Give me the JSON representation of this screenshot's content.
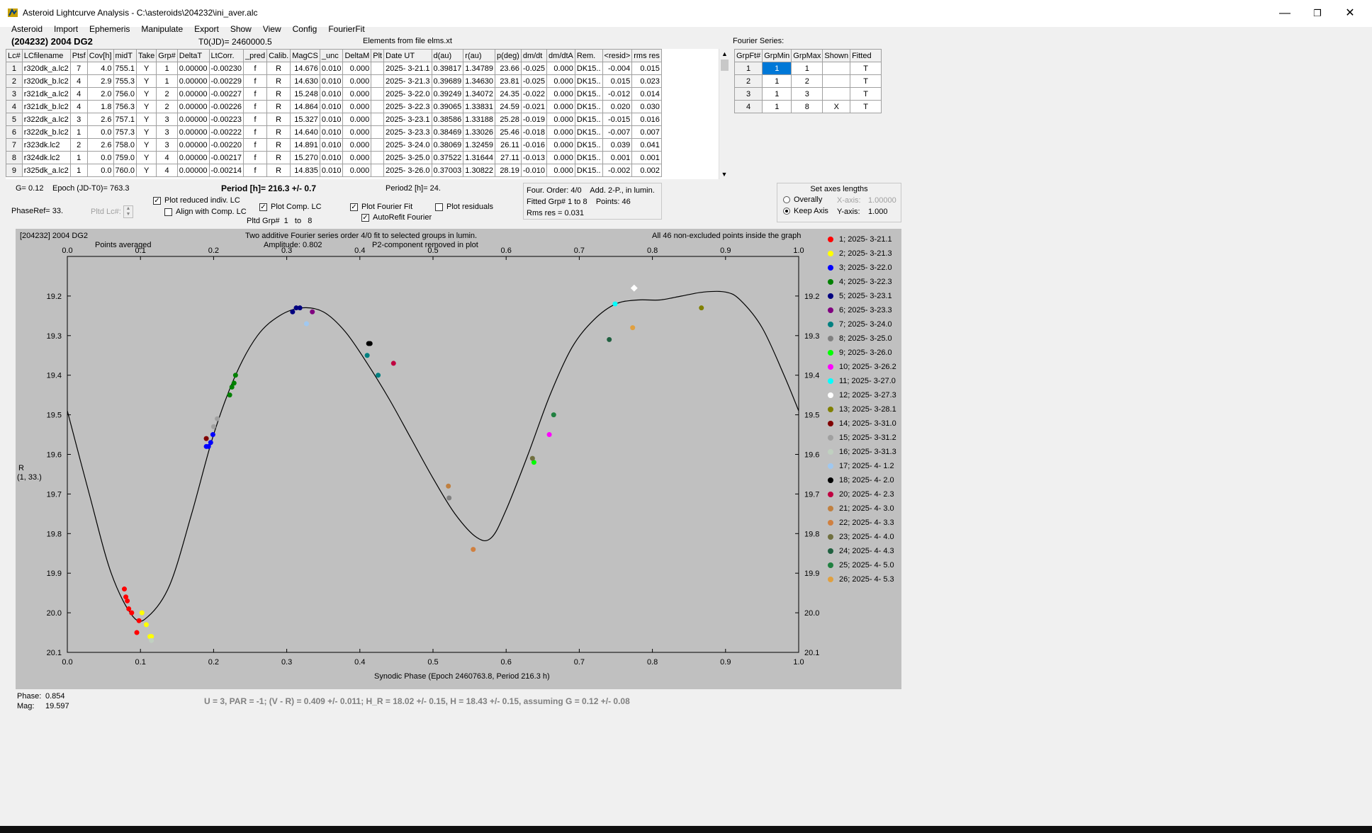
{
  "window": {
    "title": "Asteroid Lightcurve Analysis - C:\\asteroids\\204232\\ini_aver.alc"
  },
  "menu": [
    "Asteroid",
    "Import",
    "Ephemeris",
    "Manipulate",
    "Export",
    "Show",
    "View",
    "Config",
    "FourierFit"
  ],
  "header": {
    "asteroid": "(204232) 2004 DG2",
    "t0": "T0(JD)= 2460000.5",
    "elements": "Elements from file elms.xt",
    "fourier_series_label": "Fourier Series:"
  },
  "lc_table": {
    "columns": [
      "Lc#",
      "LCfilename",
      "Ptsf",
      "Cov[h]",
      "midT",
      "Take",
      "Grp#",
      "DeltaT",
      "LtCorr.",
      "_pred",
      "Calib.",
      "MagCS",
      "_unc",
      "DeltaM",
      "Plt",
      "Date UT",
      "d(au)",
      "r(au)",
      "p(deg)",
      "dm/dt",
      "dm/dtA",
      "Rem.",
      "<resid>",
      "rms res"
    ],
    "rows": [
      [
        "1",
        "r320dk_a.lc2",
        "7",
        "4.0",
        "755.1",
        "Y",
        "1",
        "0.00000",
        "-0.00230",
        "f",
        "R",
        "14.676",
        "0.010",
        "0.000",
        "",
        "2025- 3-21.1",
        "0.39817",
        "1.34789",
        "23.66",
        "-0.025",
        "0.000",
        "DK15..",
        "-0.004",
        "0.015"
      ],
      [
        "2",
        "r320dk_b.lc2",
        "4",
        "2.9",
        "755.3",
        "Y",
        "1",
        "0.00000",
        "-0.00229",
        "f",
        "R",
        "14.630",
        "0.010",
        "0.000",
        "",
        "2025- 3-21.3",
        "0.39689",
        "1.34630",
        "23.81",
        "-0.025",
        "0.000",
        "DK15..",
        "0.015",
        "0.023"
      ],
      [
        "3",
        "r321dk_a.lc2",
        "4",
        "2.0",
        "756.0",
        "Y",
        "2",
        "0.00000",
        "-0.00227",
        "f",
        "R",
        "15.248",
        "0.010",
        "0.000",
        "",
        "2025- 3-22.0",
        "0.39249",
        "1.34072",
        "24.35",
        "-0.022",
        "0.000",
        "DK15..",
        "-0.012",
        "0.014"
      ],
      [
        "4",
        "r321dk_b.lc2",
        "4",
        "1.8",
        "756.3",
        "Y",
        "2",
        "0.00000",
        "-0.00226",
        "f",
        "R",
        "14.864",
        "0.010",
        "0.000",
        "",
        "2025- 3-22.3",
        "0.39065",
        "1.33831",
        "24.59",
        "-0.021",
        "0.000",
        "DK15..",
        "0.020",
        "0.030"
      ],
      [
        "5",
        "r322dk_a.lc2",
        "3",
        "2.6",
        "757.1",
        "Y",
        "3",
        "0.00000",
        "-0.00223",
        "f",
        "R",
        "15.327",
        "0.010",
        "0.000",
        "",
        "2025- 3-23.1",
        "0.38586",
        "1.33188",
        "25.28",
        "-0.019",
        "0.000",
        "DK15..",
        "-0.015",
        "0.016"
      ],
      [
        "6",
        "r322dk_b.lc2",
        "1",
        "0.0",
        "757.3",
        "Y",
        "3",
        "0.00000",
        "-0.00222",
        "f",
        "R",
        "14.640",
        "0.010",
        "0.000",
        "",
        "2025- 3-23.3",
        "0.38469",
        "1.33026",
        "25.46",
        "-0.018",
        "0.000",
        "DK15..",
        "-0.007",
        "0.007"
      ],
      [
        "7",
        "r323dk.lc2",
        "2",
        "2.6",
        "758.0",
        "Y",
        "3",
        "0.00000",
        "-0.00220",
        "f",
        "R",
        "14.891",
        "0.010",
        "0.000",
        "",
        "2025- 3-24.0",
        "0.38069",
        "1.32459",
        "26.11",
        "-0.016",
        "0.000",
        "DK15..",
        "0.039",
        "0.041"
      ],
      [
        "8",
        "r324dk.lc2",
        "1",
        "0.0",
        "759.0",
        "Y",
        "4",
        "0.00000",
        "-0.00217",
        "f",
        "R",
        "15.270",
        "0.010",
        "0.000",
        "",
        "2025- 3-25.0",
        "0.37522",
        "1.31644",
        "27.11",
        "-0.013",
        "0.000",
        "DK15..",
        "0.001",
        "0.001"
      ],
      [
        "9",
        "r325dk_a.lc2",
        "1",
        "0.0",
        "760.0",
        "Y",
        "4",
        "0.00000",
        "-0.00214",
        "f",
        "R",
        "14.835",
        "0.010",
        "0.000",
        "",
        "2025- 3-26.0",
        "0.37003",
        "1.30822",
        "28.19",
        "-0.010",
        "0.000",
        "DK15..",
        "-0.002",
        "0.002"
      ]
    ]
  },
  "fourier_table": {
    "columns": [
      "GrpFt#",
      "GrpMin",
      "GrpMax",
      "Shown",
      "Fitted"
    ],
    "rows": [
      [
        "1",
        "1",
        "1",
        "",
        "T"
      ],
      [
        "2",
        "1",
        "2",
        "",
        "T"
      ],
      [
        "3",
        "1",
        "3",
        "",
        "T"
      ],
      [
        "4",
        "1",
        "8",
        "X",
        "T"
      ]
    ]
  },
  "controls": {
    "g": "G= 0.12",
    "epoch": "Epoch (JD-T0)= 763.3",
    "period": "Period [h]= 216.3 +/- 0.7",
    "period2": "Period2 [h]= 24.",
    "phaseref": "PhaseRef= 33.",
    "pltd_lc": "Pltd Lc#:",
    "plot_reduced": "Plot reduced indiv. LC",
    "align": "Align with Comp. LC",
    "plot_comp": "Plot Comp. LC",
    "pltd_grp": "Pltd Grp#",
    "pltd_grp_from": "1",
    "pltd_grp_to_label": "to",
    "pltd_grp_to": "8",
    "plot_fourier": "Plot Fourier Fit",
    "autorefit": "AutoRefit Fourier",
    "plot_residuals": "Plot residuals",
    "checks": {
      "plot_reduced": true,
      "align": false,
      "plot_comp": true,
      "plot_fourier": true,
      "autorefit": true,
      "plot_residuals": false
    }
  },
  "fit_info": {
    "order": "Four. Order:  4/0",
    "add": "Add. 2-P., in lumin.",
    "fitted_grp": "Fitted Grp# 1 to 8",
    "points": "Points: 46",
    "rms": "Rms res     = 0.031"
  },
  "axes_box": {
    "title": "Set axes lengths",
    "overally": "Overally",
    "keep_axis": "Keep Axis",
    "xaxis_label": "X-axis:",
    "xaxis_value": "1.00000",
    "yaxis_label": "Y-axis:",
    "yaxis_value": "1.000",
    "selected": "keep_axis"
  },
  "plot": {
    "title_left": "[204232] 2004 DG2",
    "points_averaged": "Points averaged",
    "title_center": "Two additive Fourier series order 4/0 fit to selected groups in lumin.",
    "amplitude": "Amplitude: 0.802",
    "p2": "P2-component removed in plot",
    "title_right": "All 46 non-excluded points inside the graph",
    "ylabel": "R",
    "ylabel2": "(1, 33.)",
    "xlabel": "Synodic Phase (Epoch 2460763.8, Period 216.3 h)"
  },
  "chart_data": {
    "type": "scatter",
    "xlim": [
      0,
      1
    ],
    "ylim": [
      20.1,
      19.1
    ],
    "y_inverted": true,
    "xticks": [
      "0.0",
      "0.1",
      "0.2",
      "0.3",
      "0.4",
      "0.5",
      "0.6",
      "0.7",
      "0.8",
      "0.9",
      "1.0"
    ],
    "yticks": [
      "19.2",
      "19.3",
      "19.4",
      "19.5",
      "19.6",
      "19.7",
      "19.8",
      "19.9",
      "20.0",
      "20.1"
    ],
    "fit_curve": [
      [
        0,
        19.49
      ],
      [
        0.03,
        19.7
      ],
      [
        0.06,
        19.9
      ],
      [
        0.09,
        20.01
      ],
      [
        0.11,
        20.01
      ],
      [
        0.14,
        19.93
      ],
      [
        0.17,
        19.75
      ],
      [
        0.2,
        19.55
      ],
      [
        0.23,
        19.4
      ],
      [
        0.26,
        19.3
      ],
      [
        0.29,
        19.25
      ],
      [
        0.32,
        19.23
      ],
      [
        0.35,
        19.24
      ],
      [
        0.38,
        19.29
      ],
      [
        0.41,
        19.37
      ],
      [
        0.44,
        19.46
      ],
      [
        0.47,
        19.56
      ],
      [
        0.5,
        19.66
      ],
      [
        0.53,
        19.75
      ],
      [
        0.56,
        19.81
      ],
      [
        0.58,
        19.81
      ],
      [
        0.6,
        19.74
      ],
      [
        0.63,
        19.6
      ],
      [
        0.66,
        19.45
      ],
      [
        0.69,
        19.33
      ],
      [
        0.72,
        19.26
      ],
      [
        0.75,
        19.22
      ],
      [
        0.78,
        19.21
      ],
      [
        0.81,
        19.21
      ],
      [
        0.84,
        19.2
      ],
      [
        0.87,
        19.19
      ],
      [
        0.9,
        19.19
      ],
      [
        0.92,
        19.21
      ],
      [
        0.95,
        19.28
      ],
      [
        0.98,
        19.4
      ],
      [
        1.0,
        19.49
      ]
    ],
    "series": [
      {
        "name": "1; 2025- 3-21.1",
        "color": "#ff0000",
        "points": [
          [
            0.078,
            19.94
          ],
          [
            0.08,
            19.96
          ],
          [
            0.082,
            19.97
          ],
          [
            0.084,
            19.99
          ],
          [
            0.088,
            20.0
          ],
          [
            0.095,
            20.05
          ],
          [
            0.098,
            20.02
          ]
        ]
      },
      {
        "name": "2; 2025- 3-21.3",
        "color": "#ffff00",
        "points": [
          [
            0.102,
            20.0
          ],
          [
            0.108,
            20.03
          ],
          [
            0.113,
            20.06
          ],
          [
            0.115,
            20.06
          ]
        ]
      },
      {
        "name": "3; 2025- 3-22.0",
        "color": "#0000ff",
        "points": [
          [
            0.19,
            19.58
          ],
          [
            0.193,
            19.58
          ],
          [
            0.196,
            19.57
          ],
          [
            0.199,
            19.55
          ]
        ]
      },
      {
        "name": "4; 2025- 3-22.3",
        "color": "#008000",
        "points": [
          [
            0.222,
            19.45
          ],
          [
            0.225,
            19.43
          ],
          [
            0.228,
            19.42
          ],
          [
            0.23,
            19.4
          ]
        ]
      },
      {
        "name": "5; 2025- 3-23.1",
        "color": "#000080",
        "points": [
          [
            0.308,
            19.24
          ],
          [
            0.313,
            19.23
          ],
          [
            0.318,
            19.23
          ]
        ]
      },
      {
        "name": "6; 2025- 3-23.3",
        "color": "#800080",
        "points": [
          [
            0.335,
            19.24
          ]
        ]
      },
      {
        "name": "7; 2025- 3-24.0",
        "color": "#008080",
        "points": [
          [
            0.41,
            19.35
          ],
          [
            0.425,
            19.4
          ]
        ]
      },
      {
        "name": "8; 2025- 3-25.0",
        "color": "#808080",
        "points": [
          [
            0.522,
            19.71
          ]
        ]
      },
      {
        "name": "9; 2025- 3-26.0",
        "color": "#00ff00",
        "points": [
          [
            0.638,
            19.62
          ]
        ]
      },
      {
        "name": "10; 2025- 3-26.2",
        "color": "#ff00ff",
        "points": [
          [
            0.659,
            19.55
          ]
        ]
      },
      {
        "name": "11; 2025- 3-27.0",
        "color": "#00ffff",
        "points": [
          [
            0.749,
            19.22
          ]
        ]
      },
      {
        "name": "12; 2025- 3-27.3",
        "color": "#ffffff",
        "points": [
          [
            0.775,
            19.18
          ]
        ]
      },
      {
        "name": "13; 2025- 3-28.1",
        "color": "#808000",
        "points": [
          [
            0.867,
            19.23
          ]
        ]
      },
      {
        "name": "14; 2025- 3-31.0",
        "color": "#800000",
        "points": [
          [
            0.19,
            19.56
          ]
        ]
      },
      {
        "name": "15; 2025- 3-31.2",
        "color": "#a0a0a0",
        "points": [
          [
            0.2,
            19.53
          ],
          [
            0.205,
            19.51
          ]
        ]
      },
      {
        "name": "16; 2025- 3-31.3",
        "color": "#c0d0c0",
        "points": [
          [
            0.115,
            20.07
          ]
        ]
      },
      {
        "name": "17; 2025- 4- 1.2",
        "color": "#a0c8f0",
        "points": [
          [
            0.327,
            19.27
          ]
        ]
      },
      {
        "name": "18; 2025- 4- 2.0",
        "color": "#000000",
        "points": [
          [
            0.412,
            19.32
          ],
          [
            0.414,
            19.32
          ]
        ]
      },
      {
        "name": "20; 2025- 4- 2.3",
        "color": "#c00040",
        "points": [
          [
            0.446,
            19.37
          ]
        ]
      },
      {
        "name": "21; 2025- 4- 3.0",
        "color": "#c08040",
        "points": [
          [
            0.521,
            19.68
          ]
        ]
      },
      {
        "name": "22; 2025- 4- 3.3",
        "color": "#d08040",
        "points": [
          [
            0.555,
            19.84
          ]
        ]
      },
      {
        "name": "23; 2025- 4- 4.0",
        "color": "#707040",
        "points": [
          [
            0.636,
            19.61
          ]
        ]
      },
      {
        "name": "24; 2025- 4- 4.3",
        "color": "#206040",
        "points": [
          [
            0.741,
            19.31
          ]
        ]
      },
      {
        "name": "25; 2025- 4- 5.0",
        "color": "#208040",
        "points": [
          [
            0.665,
            19.5
          ]
        ]
      },
      {
        "name": "26; 2025- 4- 5.3",
        "color": "#e0a040",
        "points": [
          [
            0.773,
            19.28
          ]
        ]
      }
    ]
  },
  "cursor": {
    "phase_label": "Phase:",
    "phase": "0.854",
    "mag_label": "Mag:",
    "mag": "19.597"
  },
  "result": "U = 3, PAR = -1; (V - R) = 0.409 +/- 0.011; H_R = 18.02 +/- 0.15, H = 18.43 +/- 0.15, assuming G = 0.12 +/- 0.08"
}
